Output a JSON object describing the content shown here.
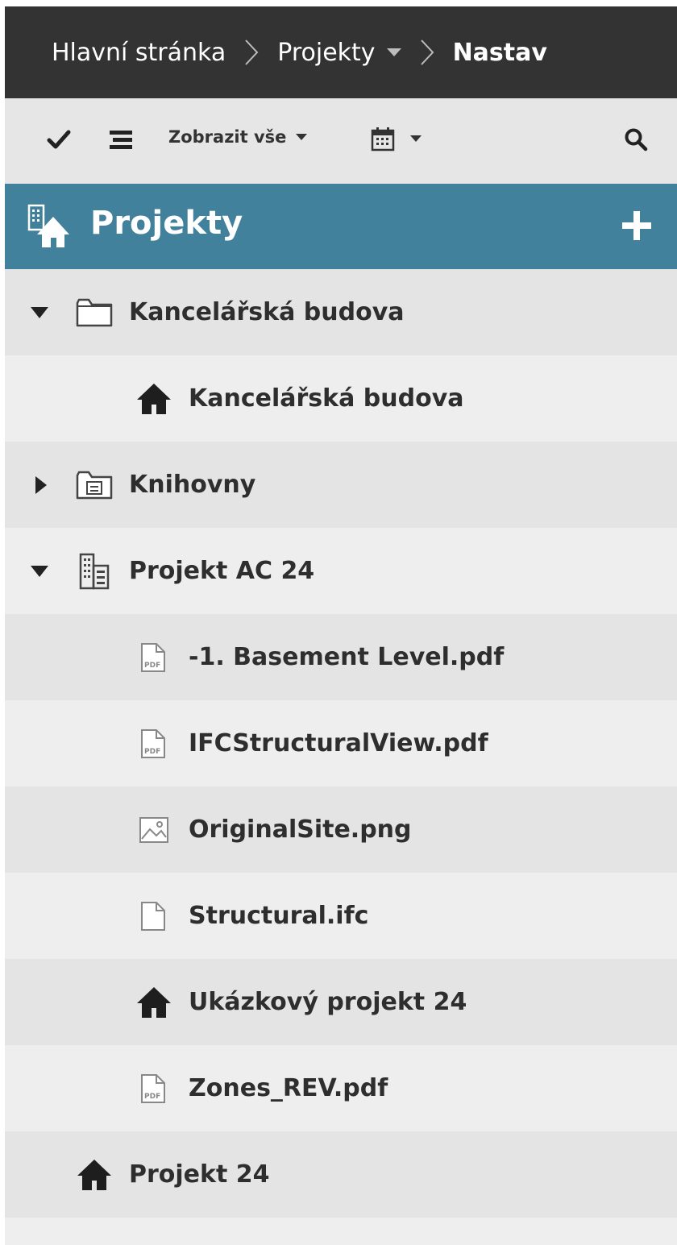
{
  "breadcrumb": {
    "home": "Hlavní stránka",
    "projects": "Projekty",
    "current": "Nastav"
  },
  "toolbar": {
    "show_all": "Zobrazit vše"
  },
  "header": {
    "title": "Projekty"
  },
  "tree": [
    {
      "label": "Kancelářská budova",
      "icon": "folder-icon",
      "expanded": true
    },
    {
      "label": "Kancelářská budova",
      "icon": "project-house-icon"
    },
    {
      "label": "Knihovny",
      "icon": "library-folder-icon",
      "expanded": false
    },
    {
      "label": "Projekt AC 24",
      "icon": "building-icon",
      "expanded": true
    },
    {
      "label": "-1. Basement Level.pdf",
      "icon": "pdf-file-icon"
    },
    {
      "label": "IFCStructuralView.pdf",
      "icon": "pdf-file-icon"
    },
    {
      "label": "OriginalSite.png",
      "icon": "image-file-icon"
    },
    {
      "label": "Structural.ifc",
      "icon": "file-icon"
    },
    {
      "label": "Ukázkový projekt 24",
      "icon": "project-house-icon"
    },
    {
      "label": "Zones_REV.pdf",
      "icon": "pdf-file-icon"
    },
    {
      "label": "Projekt 24",
      "icon": "project-house-icon"
    }
  ],
  "colors": {
    "topbar": "#333333",
    "header": "#42819b",
    "row_dark": "#e4e4e4",
    "row_light": "#eeeeee"
  }
}
